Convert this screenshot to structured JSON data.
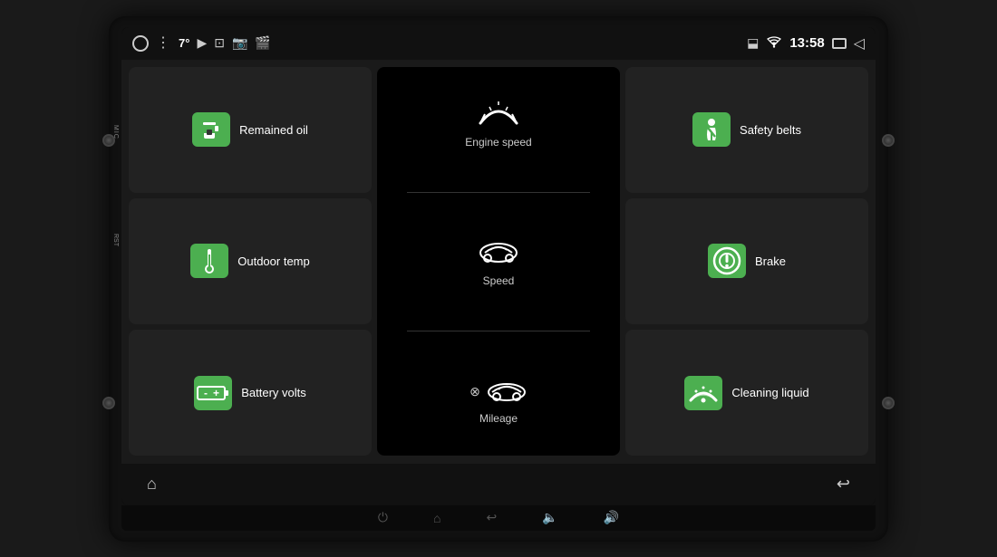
{
  "statusBar": {
    "temperature": "7°",
    "clock": "13:58"
  },
  "tiles": {
    "remained_oil": "Remained oil",
    "outdoor_temp": "Outdoor temp",
    "battery_volts": "Battery volts",
    "engine_speed": "Engine speed",
    "speed": "Speed",
    "mileage": "Mileage",
    "safety_belts": "Safety belts",
    "brake": "Brake",
    "cleaning_liquid": "Cleaning liquid"
  },
  "bottomNav": {
    "home": "⌂",
    "back": "↩"
  },
  "physicalButtons": {
    "power": "⏻",
    "home": "⌂",
    "back": "↩",
    "volDown": "🔈",
    "volUp": "🔊"
  },
  "colors": {
    "green": "#4CAF50",
    "darkBg": "#1a1a1a",
    "tileBg": "#222",
    "centerBg": "#000"
  }
}
